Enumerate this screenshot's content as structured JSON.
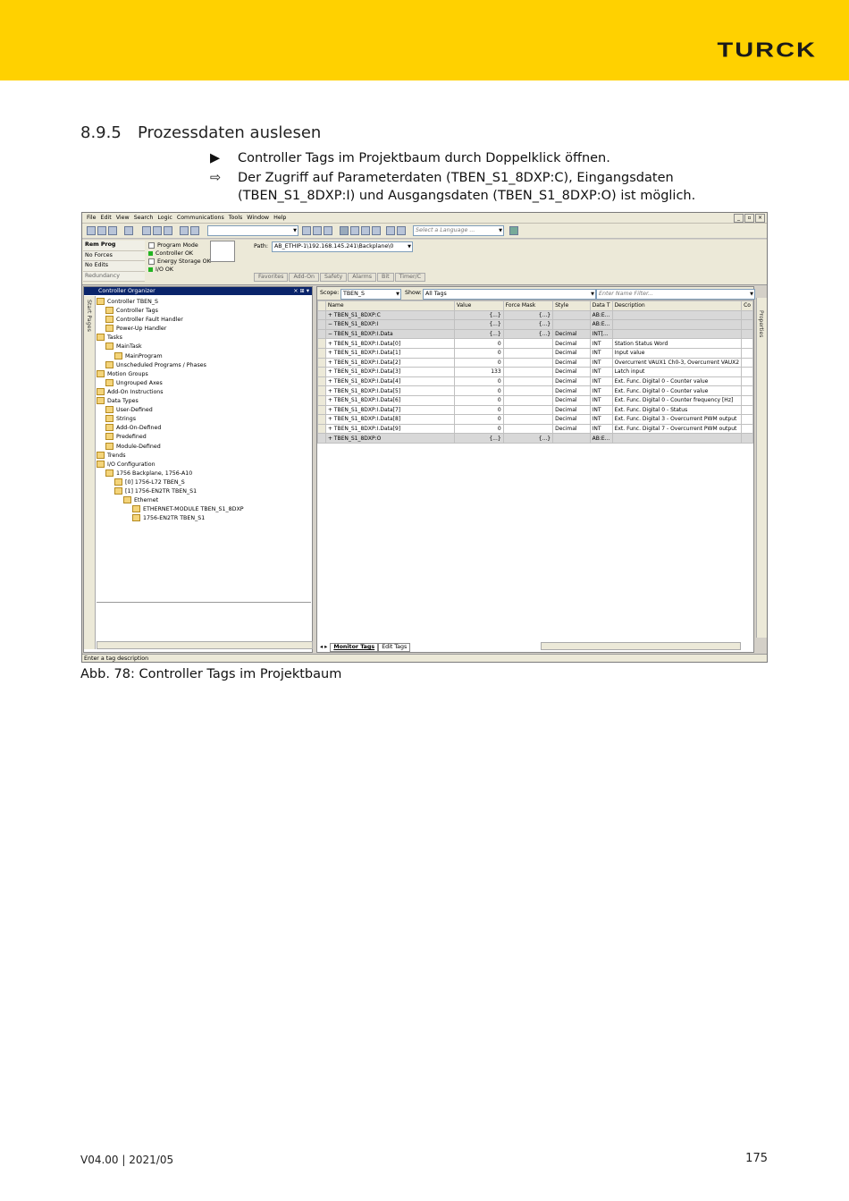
{
  "header": {
    "logo": "TURCK",
    "brand_color": "#ffd100"
  },
  "section": {
    "number": "8.9.5",
    "title": "Prozessdaten auslesen"
  },
  "steps": [
    {
      "symbol": "▶",
      "text": "Controller Tags im Projektbaum durch Doppelklick öffnen."
    },
    {
      "symbol": "⇨",
      "text": "Der Zugriff auf Parameterdaten (TBEN_S1_8DXP:C), Eingangsdaten (TBEN_S1_8DXP:I) und Ausgangsdaten (TBEN_S1_8DXP:O) ist möglich."
    }
  ],
  "screenshot": {
    "menu": [
      "File",
      "Edit",
      "View",
      "Search",
      "Logic",
      "Communications",
      "Tools",
      "Window",
      "Help"
    ],
    "language_combo": "Select a Language ...",
    "controller_status": [
      "Rem Prog",
      "No Forces",
      "No Edits",
      "Redundancy"
    ],
    "controller_leds": [
      {
        "label": "Program Mode",
        "color": "#ffffff"
      },
      {
        "label": "Controller OK",
        "color": "#22b422"
      },
      {
        "label": "Energy Storage OK",
        "color": "#ffffff"
      },
      {
        "label": "I/O OK",
        "color": "#22b422"
      }
    ],
    "path_label": "Path:",
    "path_value": "AB_ETHIP-1\\192.168.145.241\\Backplane\\0",
    "rung_tabs": [
      "Favorites",
      "Add-On",
      "Safety",
      "Alarms",
      "Bit",
      "Timer/C"
    ],
    "organizer_title": "Controller Organizer",
    "side_tab": "Start Pages",
    "tree": [
      {
        "level": 0,
        "text": "Controller TBEN_S"
      },
      {
        "level": 1,
        "text": "Controller Tags"
      },
      {
        "level": 1,
        "text": "Controller Fault Handler"
      },
      {
        "level": 1,
        "text": "Power-Up Handler"
      },
      {
        "level": 0,
        "text": "Tasks"
      },
      {
        "level": 1,
        "text": "MainTask"
      },
      {
        "level": 2,
        "text": "MainProgram"
      },
      {
        "level": 1,
        "text": "Unscheduled Programs / Phases"
      },
      {
        "level": 0,
        "text": "Motion Groups"
      },
      {
        "level": 1,
        "text": "Ungrouped Axes"
      },
      {
        "level": 0,
        "text": "Add-On Instructions"
      },
      {
        "level": 0,
        "text": "Data Types"
      },
      {
        "level": 1,
        "text": "User-Defined"
      },
      {
        "level": 1,
        "text": "Strings"
      },
      {
        "level": 1,
        "text": "Add-On-Defined"
      },
      {
        "level": 1,
        "text": "Predefined"
      },
      {
        "level": 1,
        "text": "Module-Defined"
      },
      {
        "level": 0,
        "text": "Trends"
      },
      {
        "level": 0,
        "text": "I/O Configuration"
      },
      {
        "level": 1,
        "text": "1756 Backplane, 1756-A10"
      },
      {
        "level": 2,
        "text": "[0] 1756-L72 TBEN_S"
      },
      {
        "level": 2,
        "text": "[1] 1756-EN2TR TBEN_S1"
      },
      {
        "level": 3,
        "text": "Ethernet"
      },
      {
        "level": 4,
        "text": "ETHERNET-MODULE TBEN_S1_8DXP"
      },
      {
        "level": 4,
        "text": "1756-EN2TR TBEN_S1"
      }
    ],
    "scope_label": "Scope:",
    "scope_value": "TBEN_S",
    "show_label": "Show:",
    "show_value": "All Tags",
    "filter_placeholder": "Enter Name Filter...",
    "columns": [
      "Name",
      "Value",
      "Force Mask",
      "Style",
      "Data T",
      "Description"
    ],
    "rows": [
      {
        "name": "+ TBEN_S1_8DXP:C",
        "value": "{...}",
        "force": "{...}",
        "style": "",
        "type": "AB:E...",
        "desc": "",
        "grey": true
      },
      {
        "name": "− TBEN_S1_8DXP:I",
        "value": "{...}",
        "force": "{...}",
        "style": "",
        "type": "AB:E...",
        "desc": "",
        "grey": true
      },
      {
        "name": "  − TBEN_S1_8DXP:I.Data",
        "value": "{...}",
        "force": "{...}",
        "style": "Decimal",
        "type": "INT[...",
        "desc": "",
        "grey": true
      },
      {
        "name": "    + TBEN_S1_8DXP:I.Data[0]",
        "value": "0",
        "force": "",
        "style": "Decimal",
        "type": "INT",
        "desc": "Station Status Word",
        "grey": false
      },
      {
        "name": "    + TBEN_S1_8DXP:I.Data[1]",
        "value": "0",
        "force": "",
        "style": "Decimal",
        "type": "INT",
        "desc": "Input value",
        "grey": false
      },
      {
        "name": "    + TBEN_S1_8DXP:I.Data[2]",
        "value": "0",
        "force": "",
        "style": "Decimal",
        "type": "INT",
        "desc": "Overcurrent VAUX1 Ch0-3, Overcurrent VAUX2",
        "grey": false
      },
      {
        "name": "    + TBEN_S1_8DXP:I.Data[3]",
        "value": "133",
        "force": "",
        "style": "Decimal",
        "type": "INT",
        "desc": "Latch input",
        "grey": false
      },
      {
        "name": "    + TBEN_S1_8DXP:I.Data[4]",
        "value": "0",
        "force": "",
        "style": "Decimal",
        "type": "INT",
        "desc": "Ext. Func. Digital 0 - Counter value",
        "grey": false
      },
      {
        "name": "    + TBEN_S1_8DXP:I.Data[5]",
        "value": "0",
        "force": "",
        "style": "Decimal",
        "type": "INT",
        "desc": "Ext. Func. Digital 0 - Counter value",
        "grey": false
      },
      {
        "name": "    + TBEN_S1_8DXP:I.Data[6]",
        "value": "0",
        "force": "",
        "style": "Decimal",
        "type": "INT",
        "desc": "Ext. Func. Digital 0 - Counter frequency [Hz]",
        "grey": false
      },
      {
        "name": "    + TBEN_S1_8DXP:I.Data[7]",
        "value": "0",
        "force": "",
        "style": "Decimal",
        "type": "INT",
        "desc": "Ext. Func. Digital 0 - Status",
        "grey": false
      },
      {
        "name": "    + TBEN_S1_8DXP:I.Data[8]",
        "value": "0",
        "force": "",
        "style": "Decimal",
        "type": "INT",
        "desc": "Ext. Func. Digital 3 - Overcurrent PWM output",
        "grey": false
      },
      {
        "name": "    + TBEN_S1_8DXP:I.Data[9]",
        "value": "0",
        "force": "",
        "style": "Decimal",
        "type": "INT",
        "desc": "Ext. Func. Digital 7 - Overcurrent PWM output",
        "grey": false
      },
      {
        "name": "+ TBEN_S1_8DXP:O",
        "value": "{...}",
        "force": "{...}",
        "style": "",
        "type": "AB:E...",
        "desc": "",
        "grey": true
      }
    ],
    "properties_tab": "Properties",
    "bottom_tabs": [
      "Monitor Tags",
      "Edit Tags"
    ],
    "statusbar": "Enter a tag description"
  },
  "caption": "Abb. 78: Controller Tags im Projektbaum",
  "footer": {
    "version": "V04.00 | 2021/05",
    "page": "175"
  }
}
